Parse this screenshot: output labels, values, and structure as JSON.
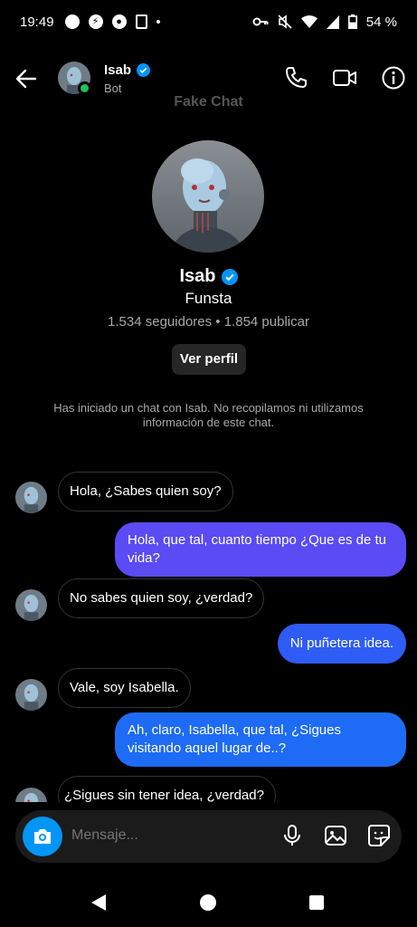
{
  "status_bar": {
    "time": "19:49",
    "battery": "54 %",
    "left_icons": [
      "notification-dot-icon",
      "app-icon",
      "vpn-icon",
      "screenshot-icon",
      "more-dot-icon"
    ],
    "right_icons": [
      "key-icon",
      "mute-icon",
      "wifi-icon",
      "signal-icon",
      "battery-icon"
    ]
  },
  "header": {
    "name": "Isab",
    "subtitle": "Bot",
    "watermark": "Fake Chat",
    "icons": [
      "back-arrow-icon",
      "phone-icon",
      "video-call-icon",
      "info-icon"
    ]
  },
  "profile": {
    "name": "Isab",
    "subtitle": "Funsta",
    "stats": "1.534 seguidores • 1.854 publicar",
    "button_label": "Ver perfil",
    "notice": "Has iniciado un chat con Isab. No recopilamos ni utilizamos información de este chat."
  },
  "messages": [
    {
      "from": "them",
      "text": "Hola, ¿Sabes quien soy?"
    },
    {
      "from": "me",
      "text": "Hola, que tal, cuanto tiempo ¿Que es de tu vida?"
    },
    {
      "from": "them",
      "text": "No sabes quien soy, ¿verdad?"
    },
    {
      "from": "me",
      "text": "Ni puñetera idea."
    },
    {
      "from": "them",
      "text": "Vale, soy Isabella."
    },
    {
      "from": "me",
      "text": "Ah, claro, Isabella, que tal, ¿Sigues visitando aquel lugar de..?"
    },
    {
      "from": "them",
      "text": "¿Sigues sin tener idea, ¿verdad?"
    }
  ],
  "composer": {
    "placeholder": "Mensaje...",
    "icons": [
      "camera-icon",
      "microphone-icon",
      "gallery-icon",
      "sticker-icon"
    ]
  },
  "colors": {
    "accent": "#0095f6",
    "bubble_out_top": "#5a4bf5",
    "bubble_out_bottom": "#1e6bf5",
    "online": "#1ec15f"
  }
}
